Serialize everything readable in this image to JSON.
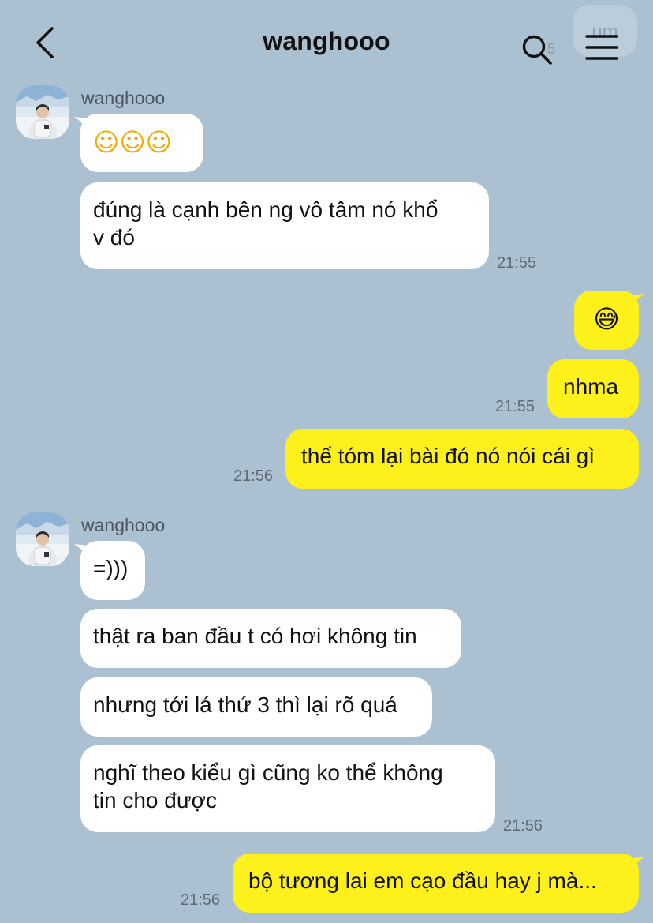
{
  "header": {
    "title": "wanghooo",
    "back_icon": "chevron-left-icon",
    "search_icon": "search-icon",
    "menu_icon": "hamburger-menu-icon",
    "ghost_bubble_text": "um",
    "ghost_time": "5"
  },
  "colors": {
    "background": "#abc1d1",
    "incoming_bubble": "#ffffff",
    "outgoing_bubble": "#fef01b"
  },
  "messages": {
    "g1": {
      "sender": "wanghooo",
      "m1": "☺☺☺",
      "m2": "đúng là cạnh bên ng vô tâm nó khổ\nv đó",
      "time": "21:55"
    },
    "o1": {
      "m1": "😅",
      "m2": "nhma",
      "time2": "21:55",
      "m3": "thế tóm lại bài đó nó nói cái gì",
      "time3": "21:56"
    },
    "g2": {
      "sender": "wanghooo",
      "m1": "=)))",
      "m2": "thật ra ban đầu t có hơi không tin",
      "m3": "nhưng tới lá thứ 3 thì lại rõ quá",
      "m4": "nghĩ theo kiểu gì cũng ko thể không\ntin cho được",
      "time": "21:56"
    },
    "o2": {
      "m1": "bộ tương lai em cạo đầu hay j mà...",
      "time": "21:56"
    }
  }
}
